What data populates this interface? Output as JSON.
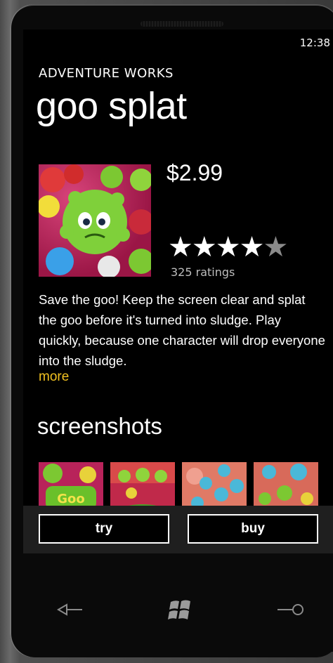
{
  "status_bar": {
    "time": "12:38"
  },
  "app": {
    "publisher": "ADVENTURE WORKS",
    "title": "goo splat",
    "price": "$2.99",
    "rating": {
      "stars": 4.5,
      "max": 5,
      "count_label": "325 ratings"
    },
    "description": "Save the goo! Keep the screen clear and splat the goo before it's turned into sludge. Play quickly, because one character will drop everyone into the sludge.",
    "more_label": "more"
  },
  "screenshots": {
    "title": "screenshots",
    "items": [
      {
        "icon": "goo-splat-logo"
      },
      {
        "icon": "green-goo-scene"
      },
      {
        "icon": "blue-goo-scene"
      },
      {
        "icon": "mixed-goo-scene"
      }
    ]
  },
  "app_bar": {
    "try_label": "try",
    "buy_label": "buy"
  },
  "nav": {
    "back": "back-icon",
    "start": "windows-icon",
    "search": "search-icon"
  },
  "colors": {
    "accent": "#f0c020",
    "background": "#000000"
  }
}
